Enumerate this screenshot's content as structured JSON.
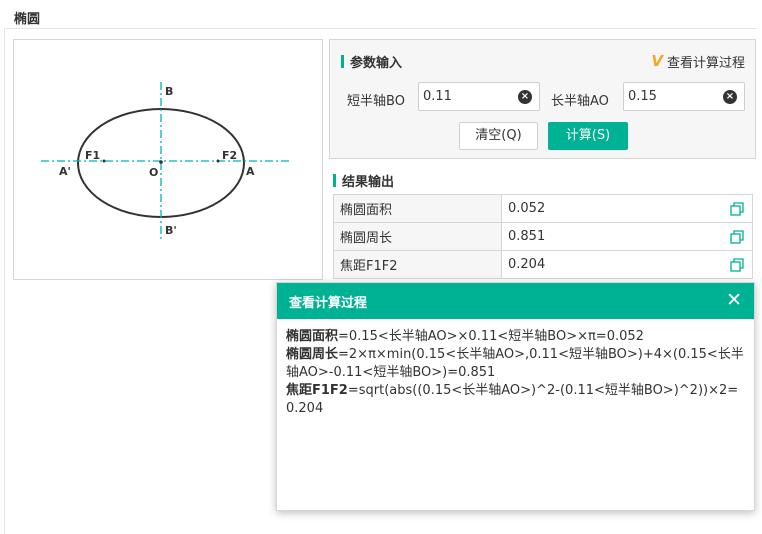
{
  "page": {
    "title": "椭圆"
  },
  "diagram": {
    "labels": {
      "B": "B",
      "B_prime": "B'",
      "A": "A",
      "A_prime": "A'",
      "O": "O",
      "F1": "F1",
      "F2": "F2"
    },
    "colors": {
      "ellipse": "#333333",
      "axis": "#00b0b6"
    }
  },
  "input": {
    "section_title": "参数输入",
    "process_link": "查看计算过程",
    "logo_icon": "vp-logo-icon",
    "short_axis_label": "短半轴BO",
    "short_axis_value": "0.11",
    "long_axis_label": "长半轴AO",
    "long_axis_value": "0.15",
    "clear_button": "清空(Q)",
    "calc_button": "计算(S)"
  },
  "output": {
    "section_title": "结果输出",
    "rows": [
      {
        "label": "椭圆面积",
        "value": "0.052"
      },
      {
        "label": "椭圆周长",
        "value": "0.851"
      },
      {
        "label": "焦距F1F2",
        "value": "0.204"
      }
    ]
  },
  "modal": {
    "title": "查看计算过程",
    "close_icon": "close-icon",
    "lines": [
      {
        "term": "椭圆面积",
        "formula": "=0.15<长半轴AO>×0.11<短半轴BO>×π=0.052"
      },
      {
        "term": "椭圆周长",
        "formula": "=2×π×min(0.15<长半轴AO>,0.11<短半轴BO>)+4×(0.15<长半轴AO>-0.11<短半轴BO>)=0.851"
      },
      {
        "term": "焦距F1F2",
        "formula": "=sqrt(abs((0.15<长半轴AO>)^2-(0.11<短半轴BO>)^2))×2=0.204"
      }
    ]
  },
  "colors": {
    "accent": "#00b294",
    "border": "#d6d6d6",
    "panel_bg": "#f6f6f6"
  }
}
